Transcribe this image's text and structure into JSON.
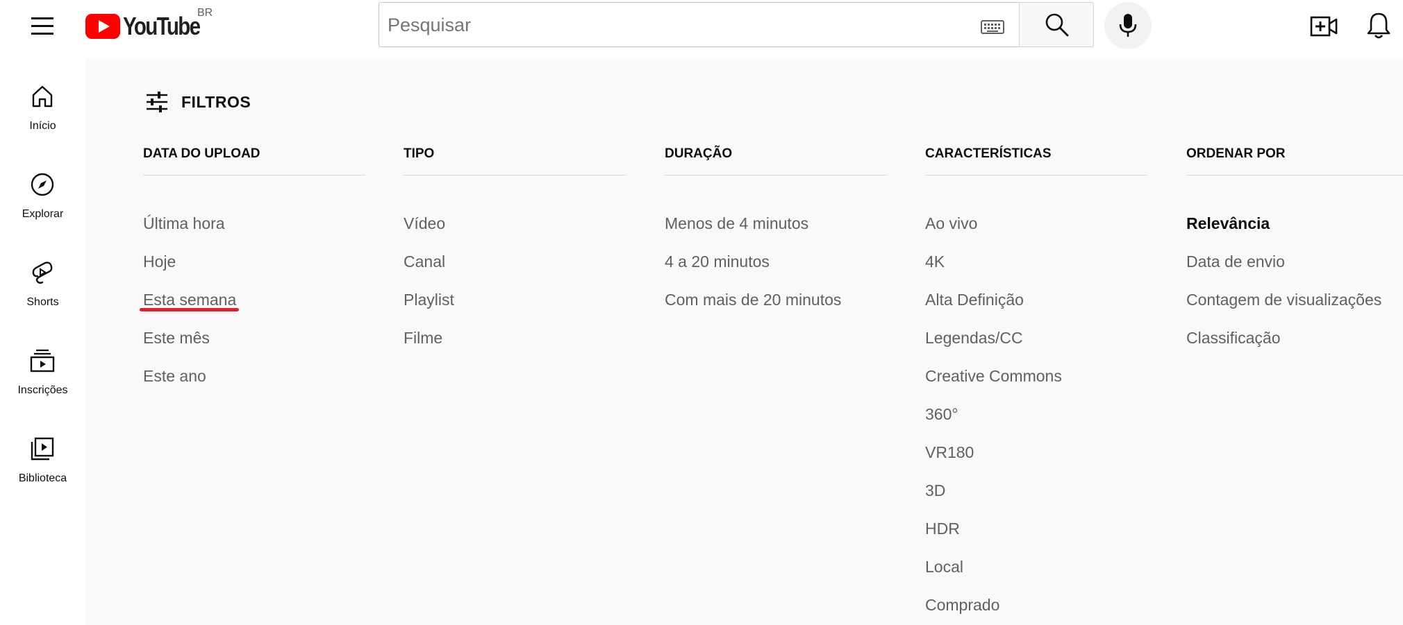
{
  "header": {
    "logo_text": "YouTube",
    "country_code": "BR",
    "search_placeholder": "Pesquisar"
  },
  "sidebar": {
    "items": [
      {
        "label": "Início",
        "icon": "home-icon"
      },
      {
        "label": "Explorar",
        "icon": "compass-icon"
      },
      {
        "label": "Shorts",
        "icon": "shorts-icon"
      },
      {
        "label": "Inscrições",
        "icon": "subscriptions-icon"
      },
      {
        "label": "Biblioteca",
        "icon": "library-icon"
      }
    ]
  },
  "filters": {
    "title": "FILTROS",
    "columns": [
      {
        "heading": "DATA DO UPLOAD",
        "options": [
          "Última hora",
          "Hoje",
          "Esta semana",
          "Este mês",
          "Este ano"
        ]
      },
      {
        "heading": "TIPO",
        "options": [
          "Vídeo",
          "Canal",
          "Playlist",
          "Filme"
        ]
      },
      {
        "heading": "DURAÇÃO",
        "options": [
          "Menos de 4 minutos",
          "4 a 20 minutos",
          "Com mais de 20 minutos"
        ]
      },
      {
        "heading": "CARACTERÍSTICAS",
        "options": [
          "Ao vivo",
          "4K",
          "Alta Definição",
          "Legendas/CC",
          "Creative Commons",
          "360°",
          "VR180",
          "3D",
          "HDR",
          "Local",
          "Comprado"
        ]
      },
      {
        "heading": "ORDENAR POR",
        "options": [
          "Relevância",
          "Data de envio",
          "Contagem de visualizações",
          "Classificação"
        ],
        "selected": "Relevância"
      }
    ],
    "highlighted_option": "Esta semana"
  },
  "colors": {
    "youtube_red": "#ff0000",
    "annotation_red": "#e0202a",
    "panel_bg": "#f9f9f9",
    "option_text": "#606060"
  }
}
